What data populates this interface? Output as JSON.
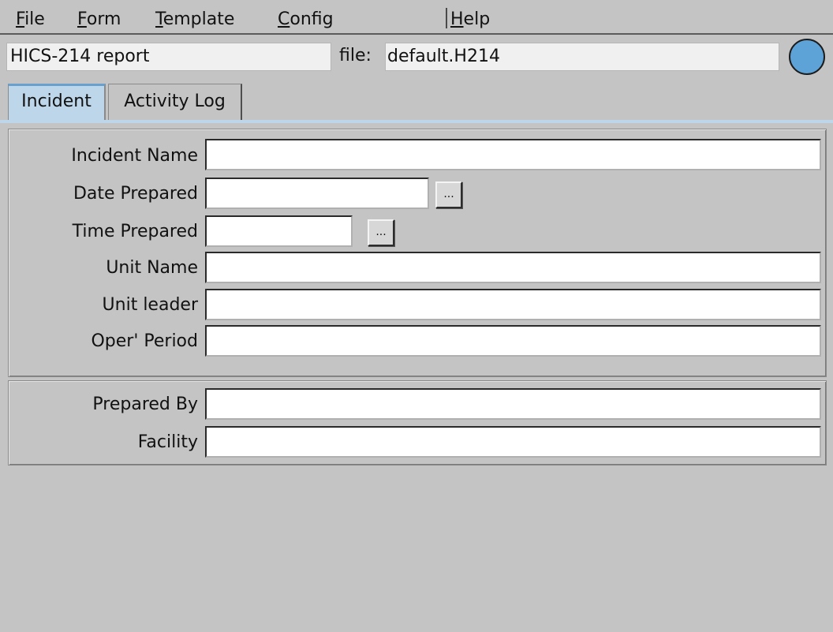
{
  "menu": {
    "file": {
      "mnemonic": "F",
      "rest": "ile"
    },
    "form": {
      "mnemonic": "F",
      "rest": "orm"
    },
    "template": {
      "mnemonic": "T",
      "rest": "emplate"
    },
    "config": {
      "mnemonic": "C",
      "rest": "onfig"
    },
    "help": {
      "mnemonic": "H",
      "rest": "elp"
    }
  },
  "header": {
    "report_title": "HICS-214 report",
    "file_label": "file:",
    "file_name": "default.H214",
    "status_color": "#5ea3d8"
  },
  "tabs": {
    "incident": "Incident",
    "activity_log": "Activity Log"
  },
  "form": {
    "incident_name": {
      "label": "Incident Name",
      "value": ""
    },
    "date_prepared": {
      "label": "Date Prepared",
      "value": "",
      "button": "..."
    },
    "time_prepared": {
      "label": "Time Prepared",
      "value": "",
      "button": "..."
    },
    "unit_name": {
      "label": "Unit Name",
      "value": ""
    },
    "unit_leader": {
      "label": "Unit leader",
      "value": ""
    },
    "oper_period": {
      "label": "Oper' Period",
      "value": ""
    },
    "prepared_by": {
      "label": "Prepared By",
      "value": ""
    },
    "facility": {
      "label": "Facility",
      "value": ""
    }
  },
  "colors": {
    "window_bg": "#c4c4c4",
    "active_tab": "#bdd6ea",
    "field_bg": "#ffffff"
  }
}
